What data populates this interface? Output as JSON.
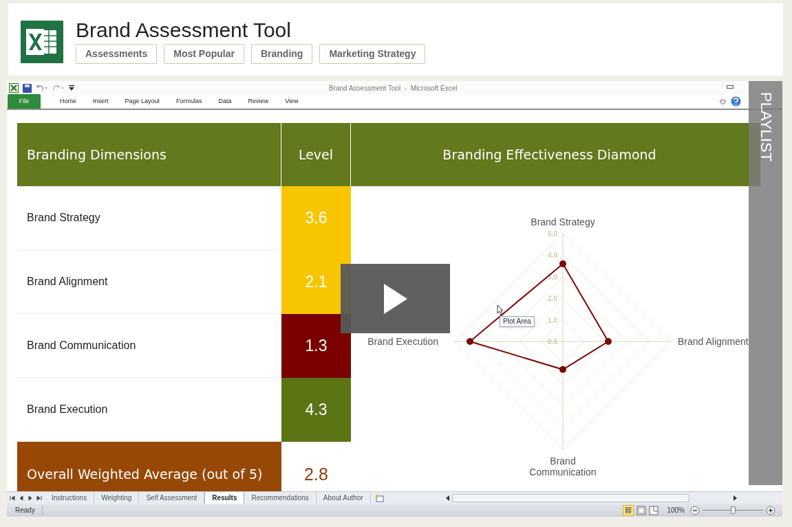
{
  "page": {
    "title": "Brand Assessment Tool",
    "tags": [
      "Assessments",
      "Most Popular",
      "Branding",
      "Marketing Strategy"
    ]
  },
  "excel": {
    "window_title": "Brand Assessment Tool  -  Microsoft Excel",
    "ribbon_tabs": [
      {
        "label": "File",
        "kind": "file"
      },
      {
        "label": "Home",
        "kind": "tab"
      },
      {
        "label": "Insert",
        "kind": "tab"
      },
      {
        "label": "Page Layout",
        "kind": "tab"
      },
      {
        "label": "Formulas",
        "kind": "tab"
      },
      {
        "label": "Data",
        "kind": "tab"
      },
      {
        "label": "Review",
        "kind": "tab"
      },
      {
        "label": "View",
        "kind": "tab"
      }
    ],
    "table": {
      "headers": [
        "Branding Dimensions",
        "Level",
        "Branding Effectiveness Diamond"
      ],
      "rows": [
        {
          "label": "Brand Strategy",
          "level": "3.6",
          "color": "#f7c600"
        },
        {
          "label": "Brand Alignment",
          "level": "2.1",
          "color": "#f7c600"
        },
        {
          "label": "Brand Communication",
          "level": "1.3",
          "color": "#7a0000"
        },
        {
          "label": "Brand Execution",
          "level": "4.3",
          "color": "#5b7514"
        }
      ],
      "overall": {
        "label": "Overall Weighted Average (out of 5)",
        "value": "2.8"
      }
    },
    "chart": {
      "axis_labels": [
        "Brand Strategy",
        "Brand Alignment",
        "Brand\nCommunication",
        "Brand Execution"
      ],
      "tooltip": "Plot Area",
      "tick_labels": [
        "5.0",
        "4.0",
        "3.0",
        "2.0",
        "1.0",
        "0.0"
      ]
    },
    "sheet_tabs": [
      {
        "label": "Instructions",
        "selected": false
      },
      {
        "label": "Weighting",
        "selected": false
      },
      {
        "label": "Self Assessment",
        "selected": false
      },
      {
        "label": "Results",
        "selected": true
      },
      {
        "label": "Recommendations",
        "selected": false
      },
      {
        "label": "About Author",
        "selected": false
      }
    ],
    "status": "Ready",
    "zoom": {
      "label": "100%",
      "level": 0.5
    }
  },
  "video": {
    "playlist": "PLAYLIST"
  }
}
